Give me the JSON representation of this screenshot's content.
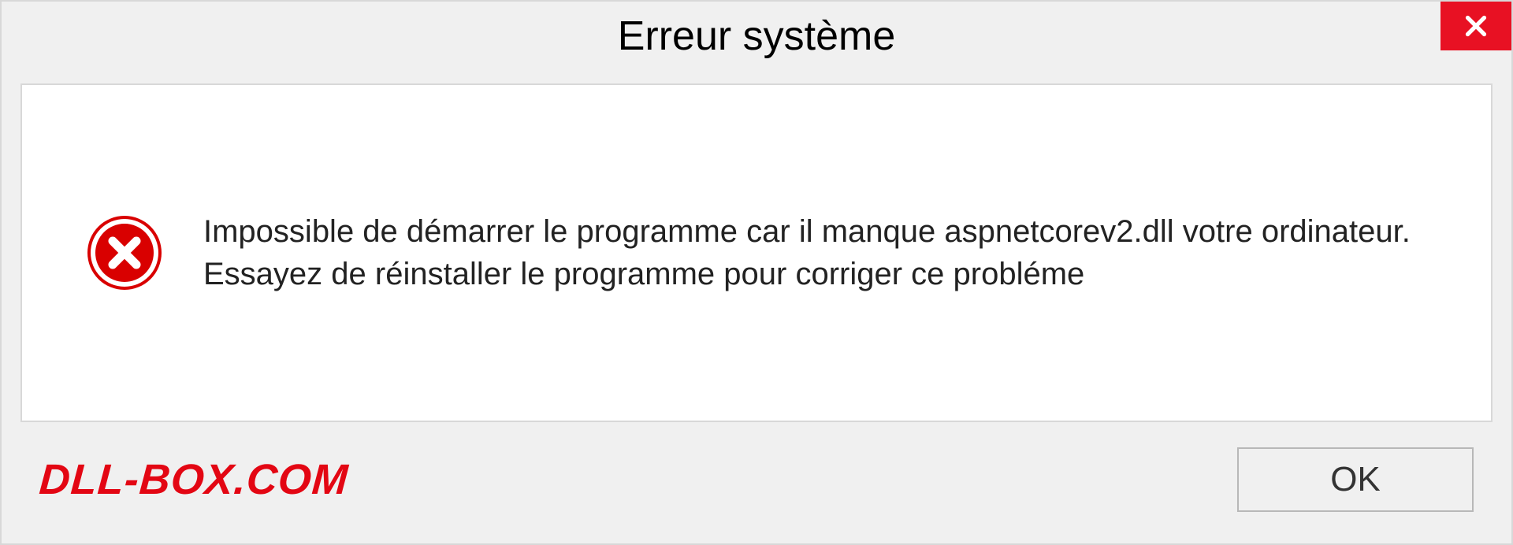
{
  "dialog": {
    "title": "Erreur système",
    "message": "Impossible de démarrer le programme car il manque aspnetcorev2.dll votre ordinateur. Essayez de réinstaller le programme pour corriger ce probléme",
    "ok_label": "OK"
  },
  "brand": {
    "text": "DLL-BOX.COM"
  }
}
